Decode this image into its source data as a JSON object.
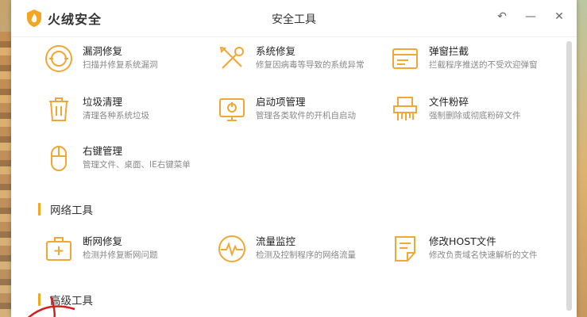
{
  "window": {
    "brand": "火绒安全",
    "title": "安全工具",
    "controls": {
      "back": "↶",
      "minimize": "—",
      "close": "✕"
    }
  },
  "tools_system": [
    {
      "name": "漏洞修复",
      "desc": "扫描并修复系统漏洞",
      "icon": "shield-repair-icon"
    },
    {
      "name": "系统修复",
      "desc": "修复因病毒等导致的系统异常",
      "icon": "wrench-screwdriver-icon"
    },
    {
      "name": "弹窗拦截",
      "desc": "拦截程序推送的不受欢迎弹窗",
      "icon": "popup-window-icon"
    },
    {
      "name": "垃圾清理",
      "desc": "清理各种系统垃圾",
      "icon": "trash-can-icon"
    },
    {
      "name": "启动项管理",
      "desc": "管理各类软件的开机自启动",
      "icon": "monitor-power-icon"
    },
    {
      "name": "文件粉碎",
      "desc": "强制删除或彻底粉碎文件",
      "icon": "shredder-icon"
    },
    {
      "name": "右键管理",
      "desc": "管理文件、桌面、IE右键菜单",
      "icon": "mouse-icon"
    }
  ],
  "sections": {
    "network": "网络工具",
    "advanced": "高级工具"
  },
  "tools_network": [
    {
      "name": "断网修复",
      "desc": "检测并修复断网问题",
      "icon": "first-aid-kit-icon"
    },
    {
      "name": "流量监控",
      "desc": "检测及控制程序的网络流量",
      "icon": "pulse-gauge-icon"
    },
    {
      "name": "修改HOST文件",
      "desc": "修改负责域名快速解析的文件",
      "icon": "document-edit-icon"
    }
  ],
  "colors": {
    "accent": "#f4a623",
    "icon_stroke": "#f0a733",
    "text": "#222222",
    "subtext": "#888888"
  }
}
